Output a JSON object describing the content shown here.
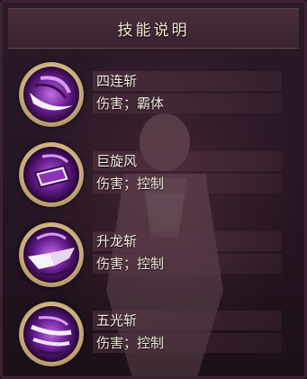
{
  "panel": {
    "title": "技能说明"
  },
  "skills": [
    {
      "name": "四连斩",
      "desc": "伤害；霸体",
      "icon": "four-slash-skill-icon"
    },
    {
      "name": "巨旋风",
      "desc": "伤害；控制",
      "icon": "giant-whirlwind-skill-icon"
    },
    {
      "name": "升龙斩",
      "desc": "伤害；控制",
      "icon": "rising-dragon-slash-skill-icon"
    },
    {
      "name": "五光斩",
      "desc": "伤害；控制",
      "icon": "five-light-slash-skill-icon"
    }
  ],
  "colors": {
    "panel_bg": "#241522",
    "title_bar": "#4a2e3c",
    "icon_frame": "#cfb483",
    "icon_purple": "#7a2fa8",
    "text": "#f1ece4"
  }
}
